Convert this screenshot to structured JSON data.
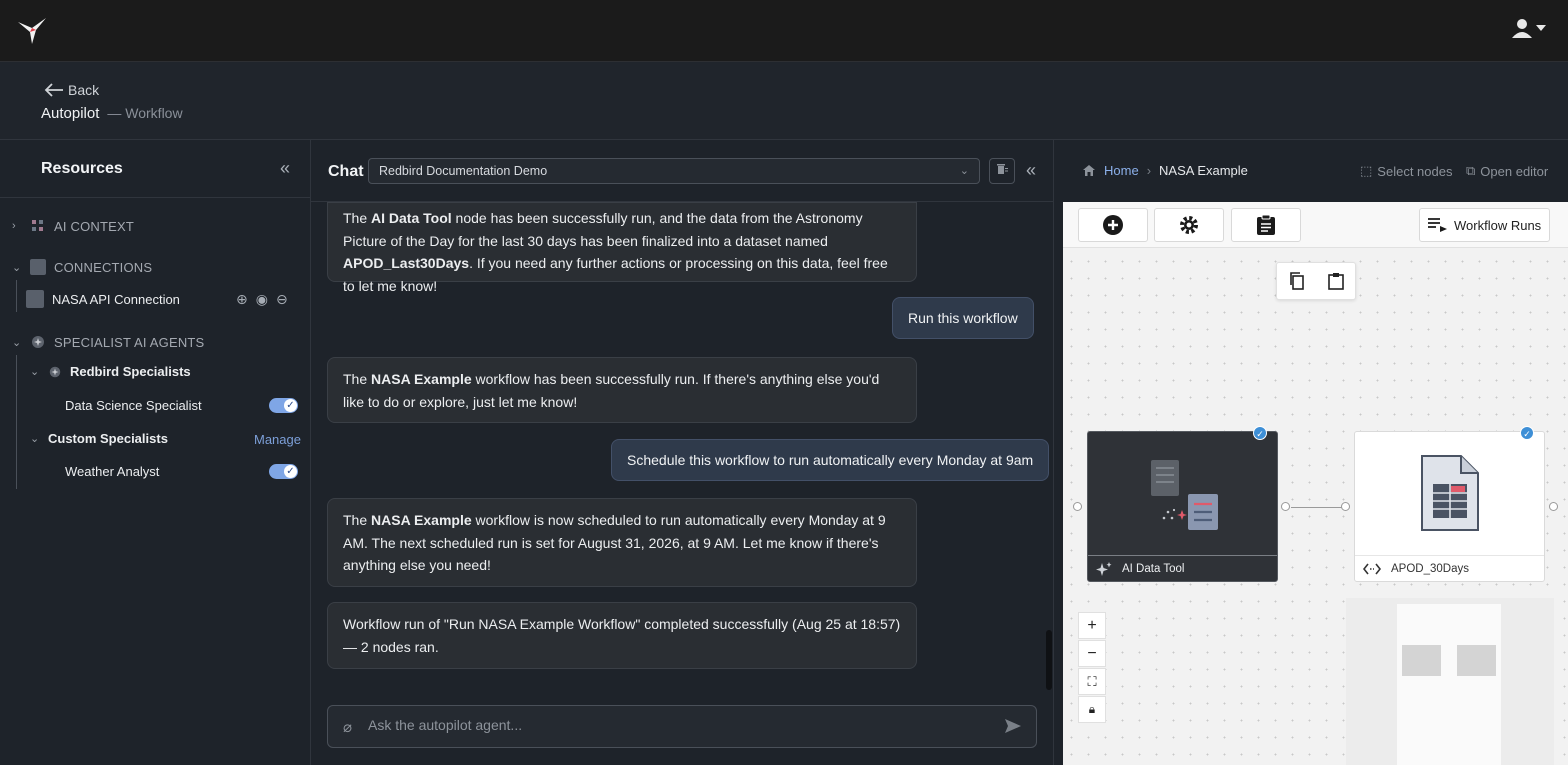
{
  "topbar": {
    "logo_icon": "hummingbird-logo",
    "user_icon": "user-icon"
  },
  "pagehead": {
    "back_label": "Back",
    "title": "Autopilot",
    "subtitle": "— Workflow"
  },
  "resources": {
    "title": "Resources",
    "sections": {
      "ai_context": "AI CONTEXT",
      "connections": "CONNECTIONS",
      "connection_item": "NASA API Connection",
      "specialists": "SPECIALIST AI AGENTS",
      "redbird": "Redbird Specialists",
      "data_science": "Data Science Specialist",
      "custom": "Custom Specialists",
      "manage": "Manage",
      "weather": "Weather Analyst"
    },
    "toggles": {
      "data_science_enabled": true,
      "weather_enabled": true
    }
  },
  "chat": {
    "title": "Chat",
    "selected_chat": "Redbird Documentation Demo",
    "messages": [
      {
        "role": "assistant",
        "parts": [
          {
            "t": "The "
          },
          {
            "b": "AI Data Tool"
          },
          {
            "t": " node has been successfully run, and the data from the Astronomy Picture of the Day for the last 30 days has been finalized into a dataset named "
          },
          {
            "b": "APOD_Last30Days"
          },
          {
            "t": ". If you need any further actions or processing on this data, feel free to let me know!"
          }
        ]
      },
      {
        "role": "user",
        "text": "Run this workflow"
      },
      {
        "role": "assistant",
        "parts": [
          {
            "t": "The "
          },
          {
            "b": "NASA Example"
          },
          {
            "t": " workflow has been successfully run. If there's anything else you'd like to do or explore, just let me know!"
          }
        ]
      },
      {
        "role": "user",
        "text": "Schedule this workflow to run automatically every Monday at 9am"
      },
      {
        "role": "assistant",
        "parts": [
          {
            "t": "The "
          },
          {
            "b": "NASA Example"
          },
          {
            "t": " workflow is now scheduled to run automatically every Monday at 9 AM. The next scheduled run is set for August 31, 2026, at 9 AM. Let me know if there's anything else you need!"
          }
        ]
      },
      {
        "role": "assistant",
        "parts": [
          {
            "t": "Workflow run of \"Run NASA Example Workflow\" completed successfully (Aug 25 at 18:57) — 2 nodes ran."
          }
        ]
      }
    ],
    "input_placeholder": "Ask the autopilot agent..."
  },
  "workflow": {
    "breadcrumb": {
      "home": "Home",
      "current": "NASA Example"
    },
    "select_nodes": "Select nodes",
    "open_editor": "Open editor",
    "toolbar": {
      "runs_label": "Workflow Runs"
    },
    "nodes": [
      {
        "label": "AI Data Tool",
        "type": "ai-tool",
        "selected": true
      },
      {
        "label": "APOD_30Days",
        "type": "dataset",
        "selected": true
      }
    ]
  },
  "colors": {
    "accent": "#7c9fd8",
    "toggle": "#7fa6e6",
    "user_bubble": "#2f3a4b"
  }
}
